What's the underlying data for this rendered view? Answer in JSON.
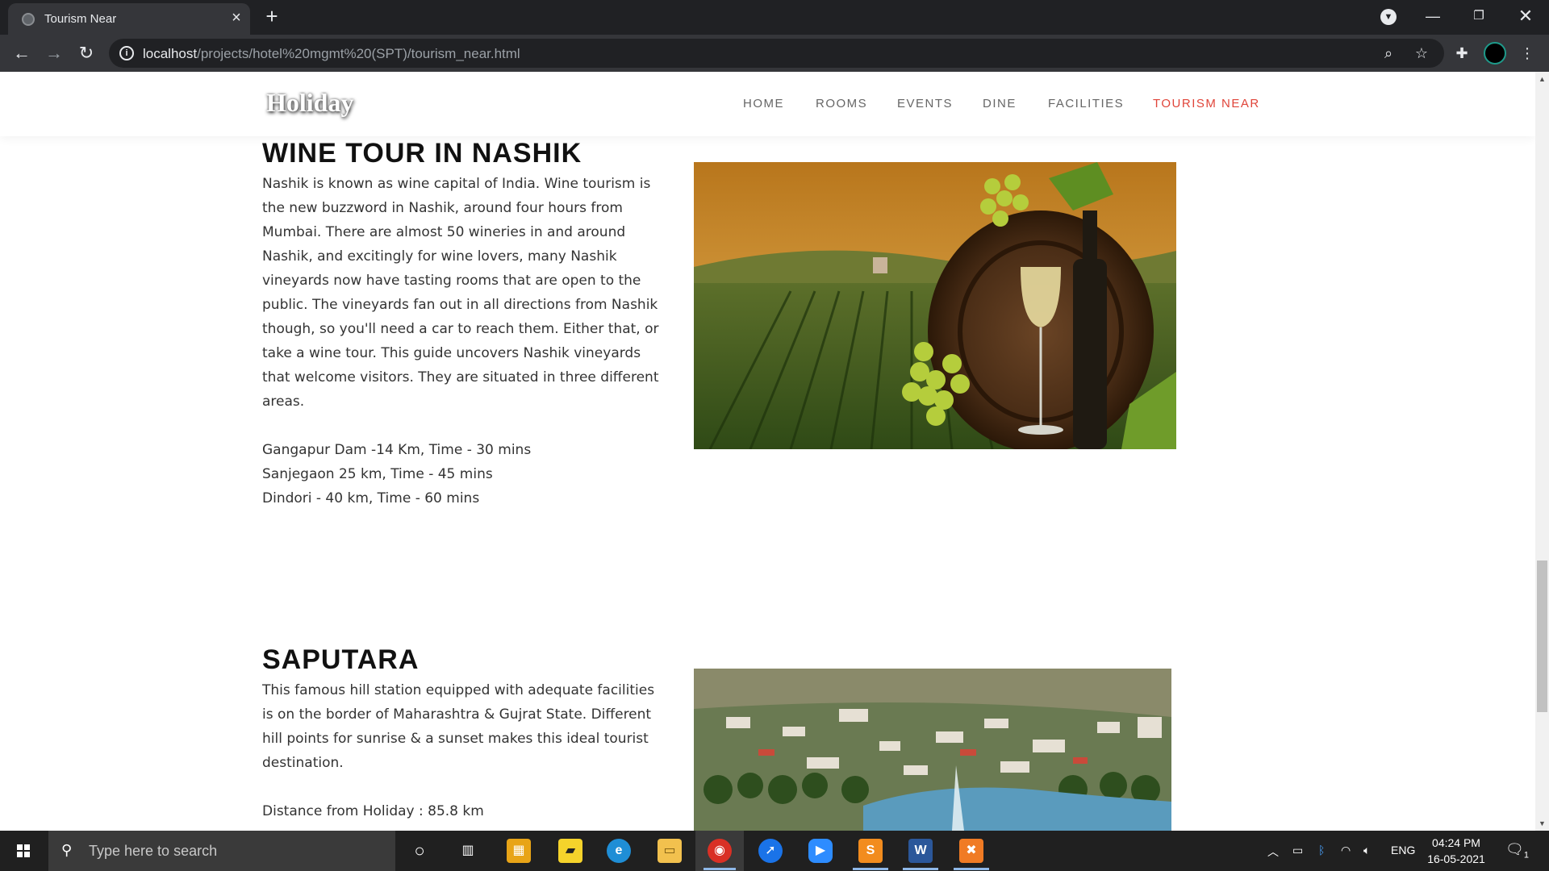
{
  "browser": {
    "tab_title": "Tourism Near",
    "url_host": "localhost",
    "url_path": "/projects/hotel%20mgmt%20(SPT)/tourism_near.html"
  },
  "site": {
    "logo": "Holiday",
    "nav": [
      "HOME",
      "ROOMS",
      "EVENTS",
      "DINE",
      "FACILITIES",
      "TOURISM NEAR"
    ],
    "active_nav": "TOURISM NEAR",
    "active_color": "#e0453a"
  },
  "sections": [
    {
      "title": "WINE TOUR IN NASHIK",
      "description": "Nashik is known as wine capital of India. Wine tourism is the new buzzword in Nashik, around four hours from Mumbai. There are almost 50 wineries in and around Nashik, and excitingly for wine lovers, many Nashik vineyards now have tasting rooms that are open to the public. The vineyards fan out in all directions from Nashik though, so you'll need a car to reach them. Either that, or take a wine tour. This guide uncovers Nashik vineyards that welcome visitors. They are situated in three different areas.",
      "details": [
        "Gangapur Dam -14 Km, Time - 30 mins",
        "Sanjegaon 25 km, Time - 45 mins",
        "Dindori - 40 km, Time - 60 mins"
      ]
    },
    {
      "title": "SAPUTARA",
      "description": "This famous hill station equipped with adequate facilities is on the border of Maharashtra & Gujrat State. Different hill points for sunrise & a sunset makes this ideal tourist destination.",
      "details": [
        "Distance from Holiday : 85.8 km"
      ]
    }
  ],
  "taskbar": {
    "search_placeholder": "Type here to search",
    "language": "ENG",
    "time": "04:24 PM",
    "date": "16-05-2021",
    "notification_count": "1"
  }
}
